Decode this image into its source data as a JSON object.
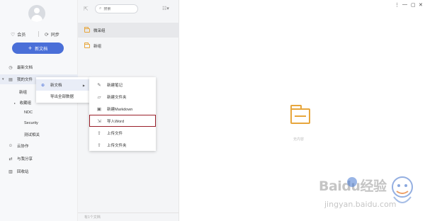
{
  "sidebar": {
    "quick": {
      "member_label": "会员",
      "sync_label": "同步"
    },
    "new_doc_label": "新文档",
    "nav": {
      "recent_label": "最新文档",
      "my_files_label": "我的文件",
      "collab_label": "云协作",
      "shared_label": "与我分享",
      "trash_label": "回收站"
    },
    "tree": {
      "new_folder": "新组",
      "collected": "收藏组",
      "ndc": "NDC",
      "security": "Security",
      "testing": "测试相关"
    }
  },
  "list": {
    "search_placeholder": "搜索",
    "folders": [
      {
        "name": "微采组"
      },
      {
        "name": "新组"
      }
    ],
    "footer_text": "有1个文档"
  },
  "context_menu": {
    "new_doc_label": "新文档",
    "export_label": "导出全部数据"
  },
  "submenu": {
    "items": [
      {
        "label": "新建笔记",
        "icon": "note-icon"
      },
      {
        "label": "新建文件夹",
        "icon": "folder-add-icon"
      },
      {
        "label": "新建Markdown",
        "icon": "markdown-icon"
      },
      {
        "label": "导入Word",
        "icon": "import-word-icon"
      },
      {
        "label": "上传文件",
        "icon": "upload-file-icon"
      },
      {
        "label": "上传文件夹",
        "icon": "upload-folder-icon"
      }
    ]
  },
  "content": {
    "empty_text": "无内容"
  },
  "window": {
    "controls": [
      "⋮",
      "—",
      "▢",
      "✕"
    ]
  },
  "watermark": {
    "brand": "Baidu经验",
    "url": "jingyan.baidu.com"
  },
  "colors": {
    "accent": "#4a6fd8",
    "folder": "#e7a63c",
    "highlight_box": "#9a1f2a"
  }
}
